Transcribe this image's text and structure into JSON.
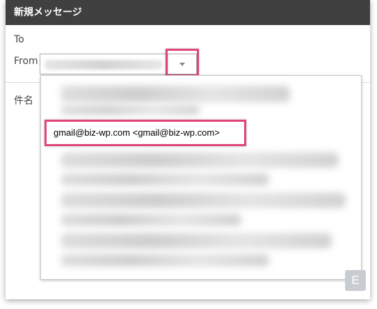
{
  "window": {
    "title": "新規メッセージ"
  },
  "fields": {
    "to_label": "To",
    "from_label": "From",
    "subject_label": "件名"
  },
  "from_dropdown": {
    "highlighted_option": "gmail@biz-wp.com <gmail@biz-wp.com>"
  },
  "corner_badge": "E",
  "colors": {
    "titlebar": "#404040",
    "highlight": "#e0457b"
  }
}
